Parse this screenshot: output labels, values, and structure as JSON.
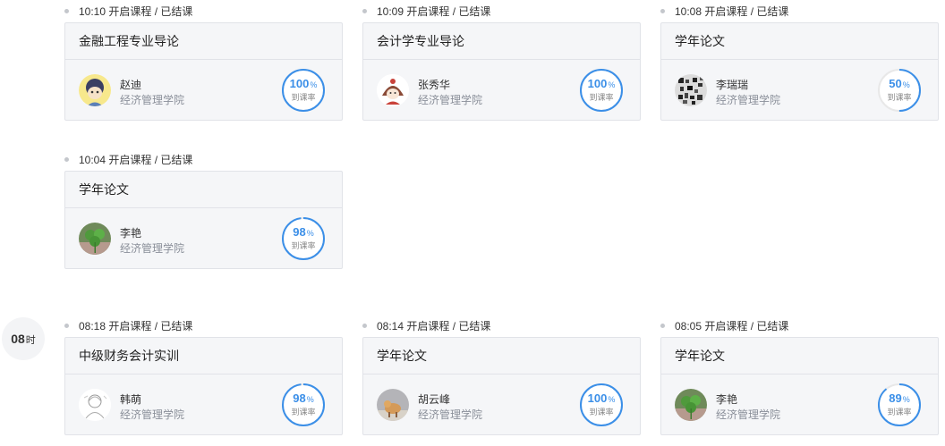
{
  "hour_badge": {
    "hour": "08",
    "unit": "时"
  },
  "rate_label": "到课率",
  "rate_unit": "%",
  "accent_color": "#3b8fe8",
  "track_color": "#e8e8e8",
  "sessions": [
    {
      "time": "10:10 开启课程 / 已结课",
      "course": "金融工程专业导论",
      "teacher": "赵迪",
      "college": "经济管理学院",
      "rate": 100,
      "avatar_icon": "cartoon-avatar-icon"
    },
    {
      "time": "10:09 开启课程 / 已结课",
      "course": "会计学专业导论",
      "teacher": "张秀华",
      "college": "经济管理学院",
      "rate": 100,
      "avatar_icon": "cartoon-girl-avatar-icon"
    },
    {
      "time": "10:08 开启课程 / 已结课",
      "course": "学年论文",
      "teacher": "李瑞瑞",
      "college": "经济管理学院",
      "rate": 50,
      "avatar_icon": "qr-pattern-avatar-icon"
    },
    {
      "time": "10:04 开启课程 / 已结课",
      "course": "学年论文",
      "teacher": "李艳",
      "college": "经济管理学院",
      "rate": 98,
      "avatar_icon": "clover-avatar-icon"
    },
    {
      "time": "08:18 开启课程 / 已结课",
      "course": "中级财务会计实训",
      "teacher": "韩萌",
      "college": "经济管理学院",
      "rate": 98,
      "avatar_icon": "sketch-avatar-icon"
    },
    {
      "time": "08:14 开启课程 / 已结课",
      "course": "学年论文",
      "teacher": "胡云峰",
      "college": "经济管理学院",
      "rate": 100,
      "avatar_icon": "animal-avatar-icon"
    },
    {
      "time": "08:05 开启课程 / 已结课",
      "course": "学年论文",
      "teacher": "李艳",
      "college": "经济管理学院",
      "rate": 89,
      "avatar_icon": "clover-avatar-icon"
    }
  ]
}
